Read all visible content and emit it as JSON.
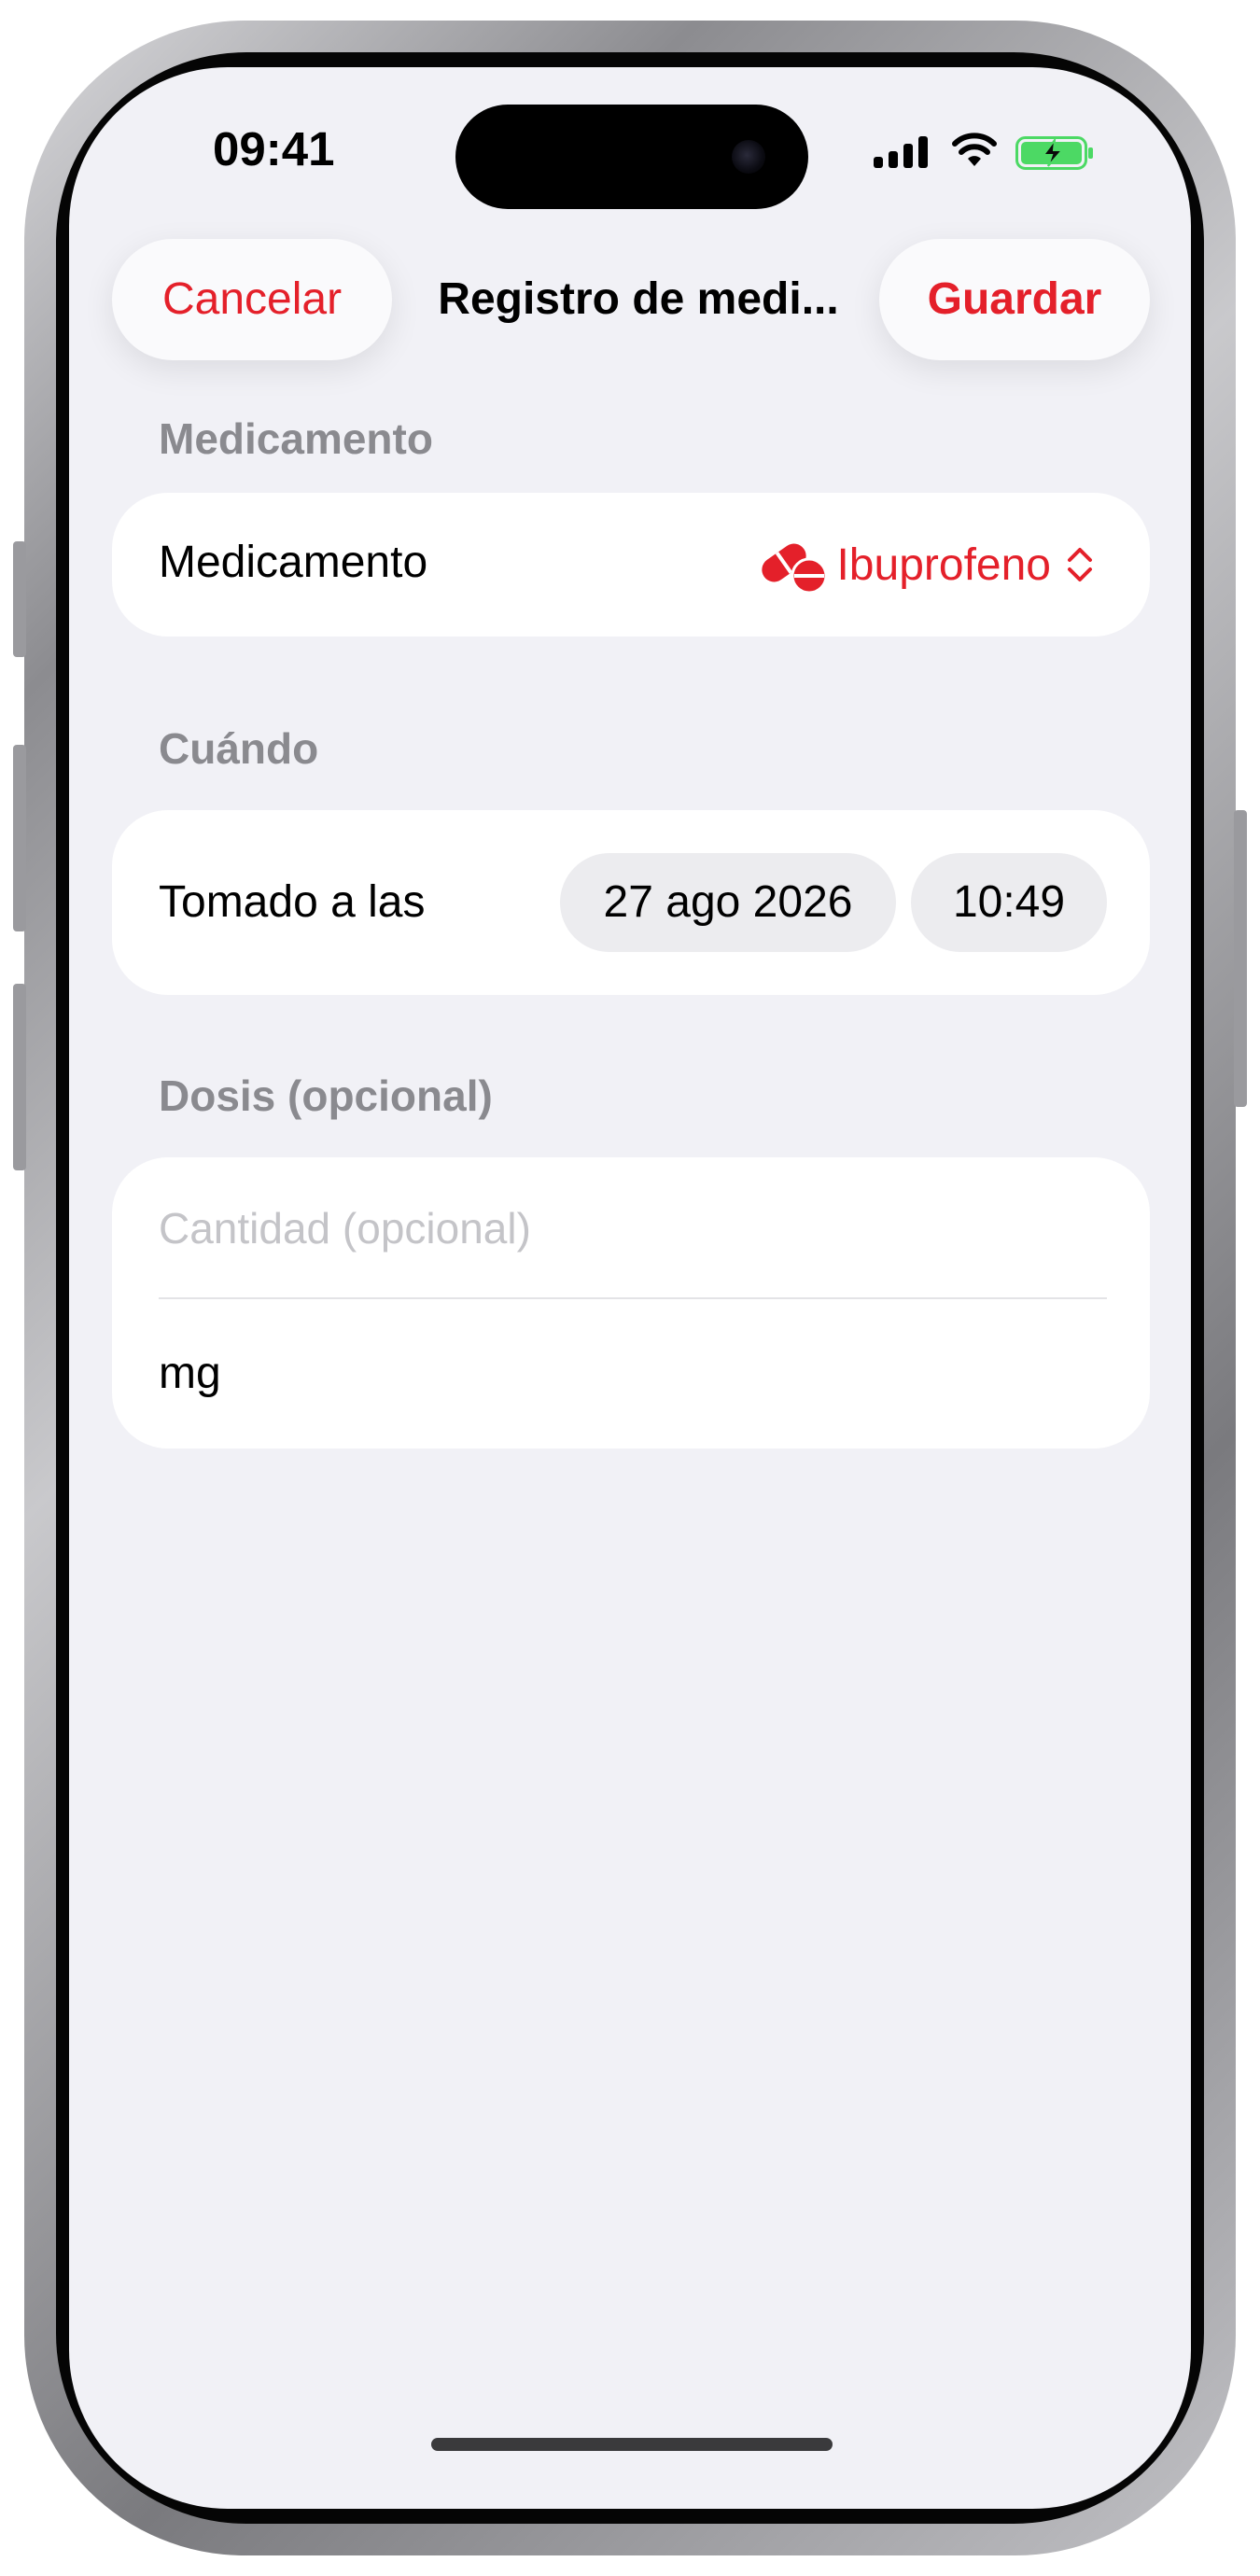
{
  "status_bar": {
    "time": "09:41",
    "icons": [
      "cellular-signal-icon",
      "wifi-icon",
      "battery-charging-icon"
    ],
    "battery_color": "#4cd964"
  },
  "nav": {
    "cancel_label": "Cancelar",
    "title": "Registro de medi...",
    "save_label": "Guardar"
  },
  "colors": {
    "accent": "#e4202a",
    "background": "#f1f1f6",
    "section_header": "#8a8a8f"
  },
  "medication_section": {
    "header": "Medicamento",
    "row_label": "Medicamento",
    "selected_value": "Ibuprofeno",
    "icon": "pills-icon",
    "selector_icon": "chevron-up-down-icon"
  },
  "when_section": {
    "header": "Cuándo",
    "row_label": "Tomado a las",
    "date": "27 ago 2026",
    "time": "10:49"
  },
  "dose_section": {
    "header": "Dosis (opcional)",
    "amount_placeholder": "Cantidad (opcional)",
    "amount_value": "",
    "unit": "mg"
  }
}
